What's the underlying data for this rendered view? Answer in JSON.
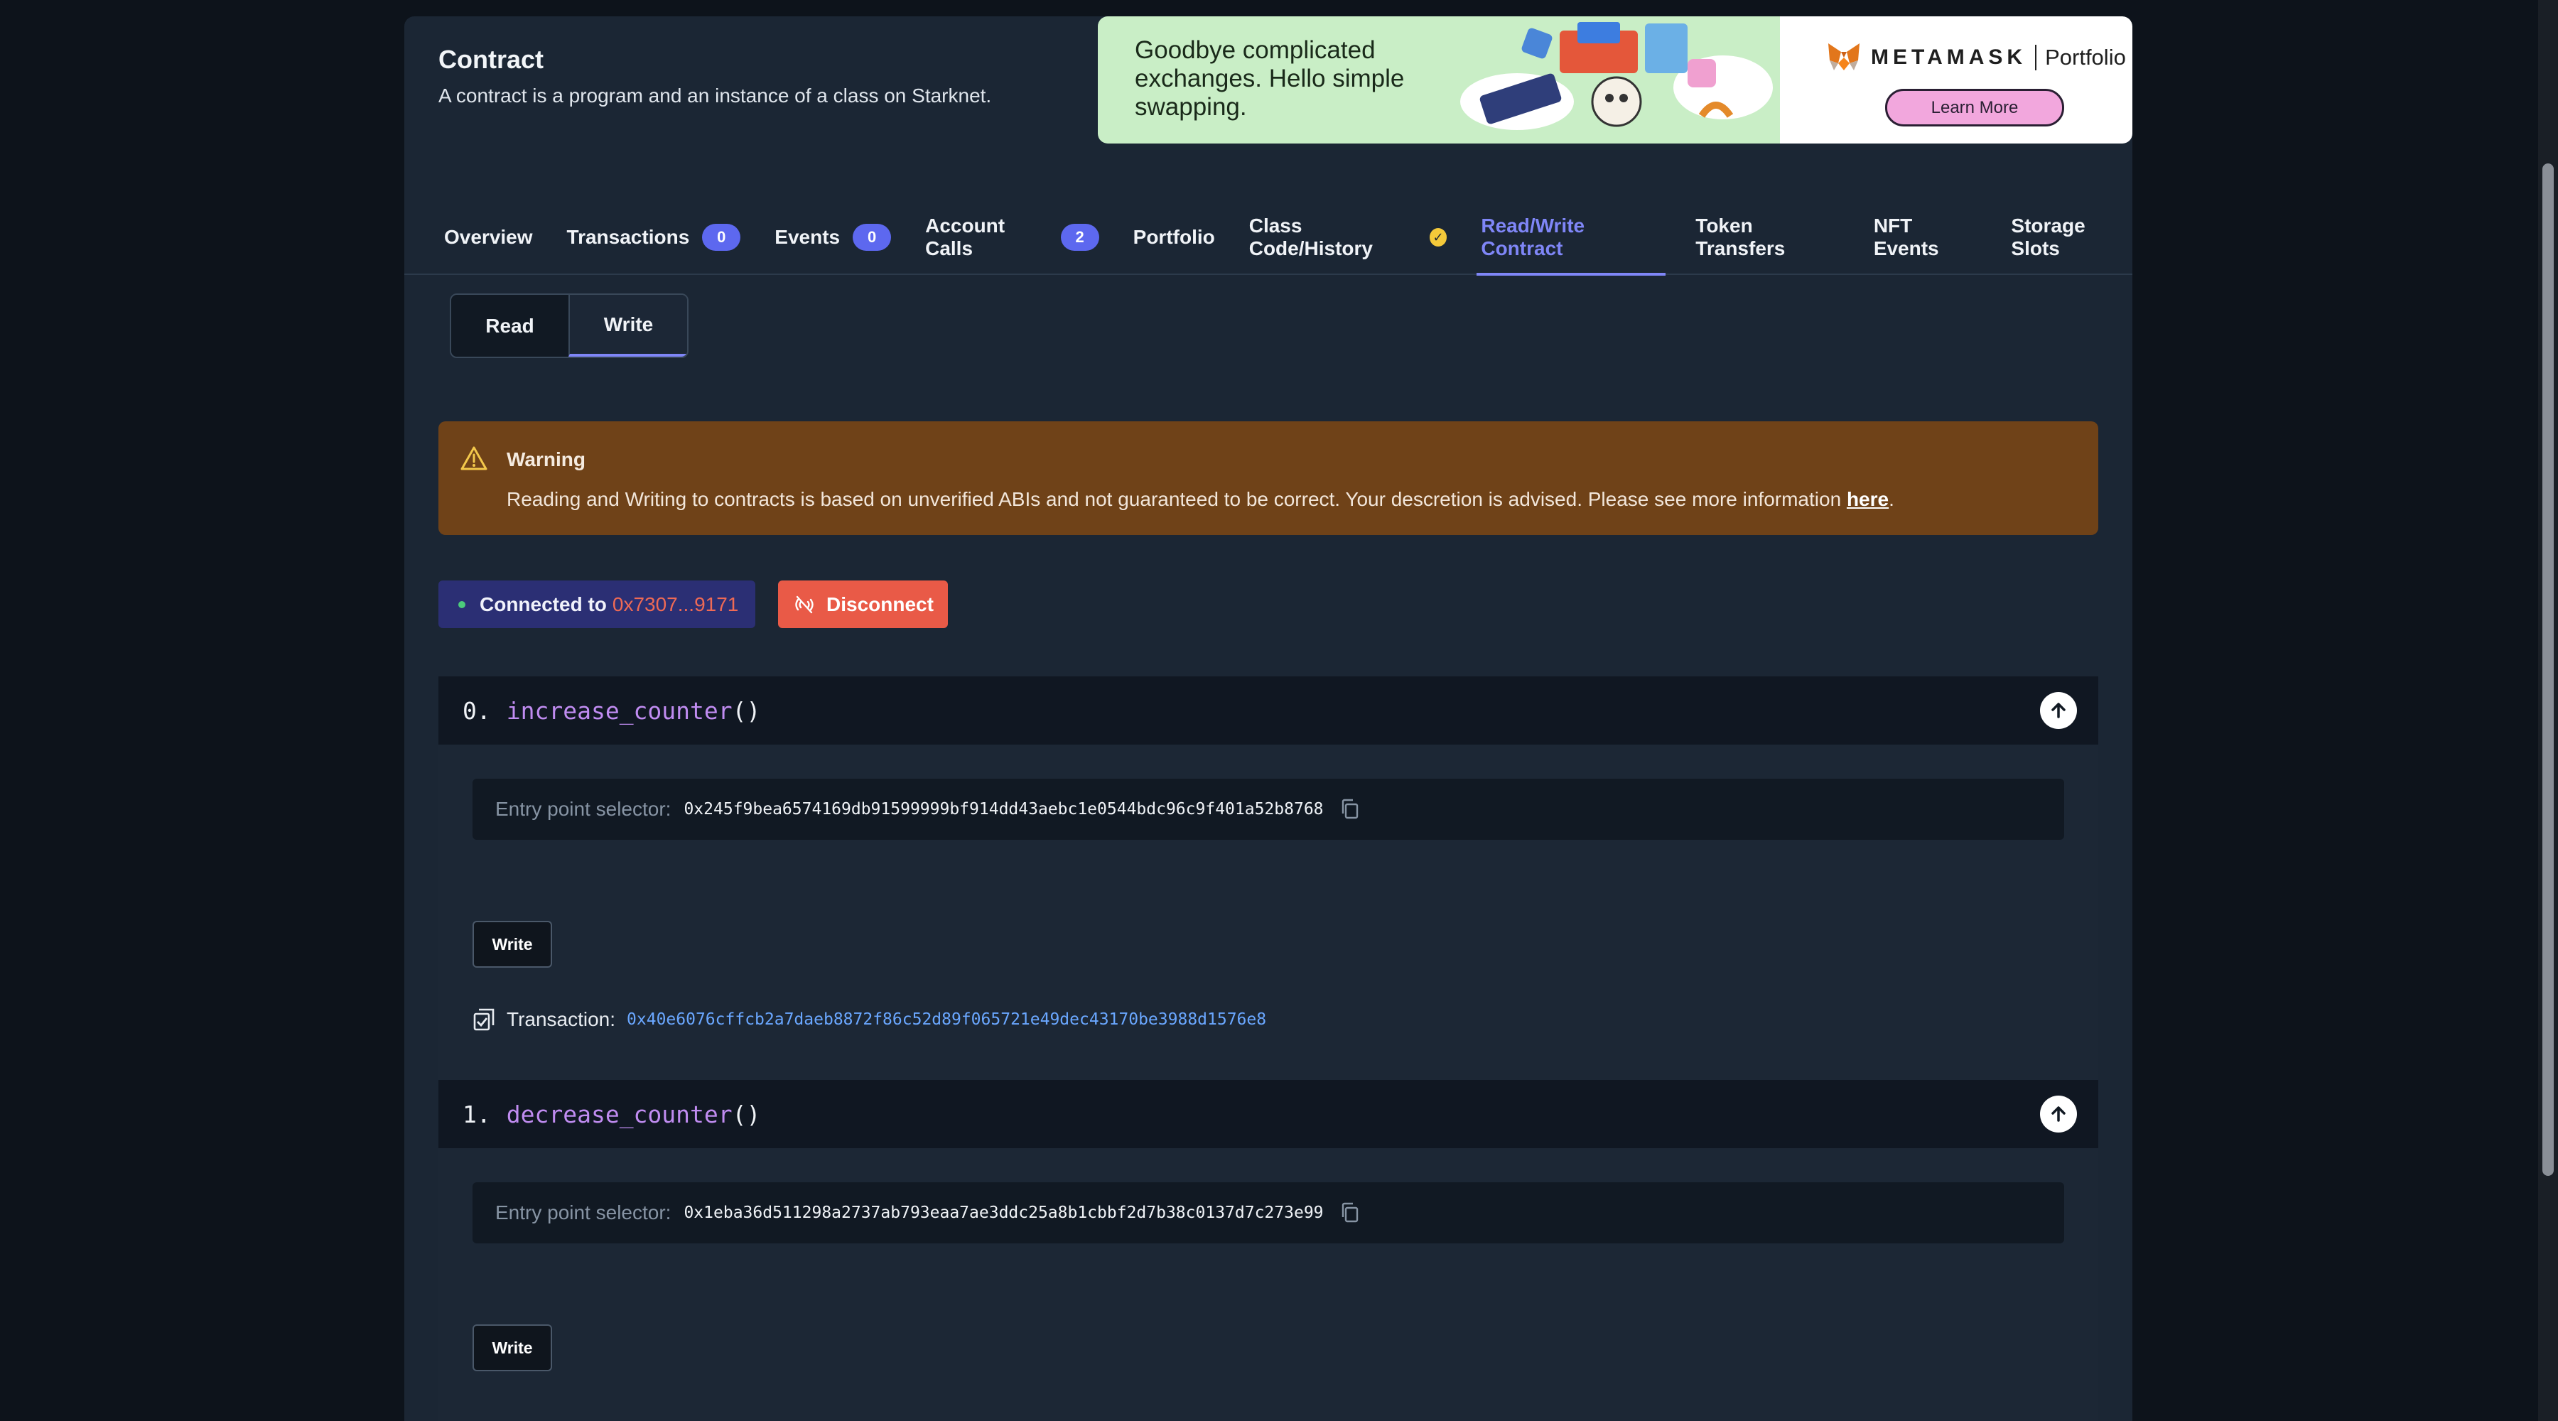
{
  "header": {
    "title": "Contract",
    "subtitle": "A contract is a program and an instance of a class on Starknet."
  },
  "ad": {
    "headline": "Goodbye complicated exchanges. Hello simple swapping.",
    "brand": "METAMASK",
    "product": "Portfolio",
    "cta": "Learn More"
  },
  "tabs": [
    {
      "label": "Overview"
    },
    {
      "label": "Transactions",
      "count": "0"
    },
    {
      "label": "Events",
      "count": "0"
    },
    {
      "label": "Account Calls",
      "count": "2"
    },
    {
      "label": "Portfolio"
    },
    {
      "label": "Class Code/History",
      "verified_icon": "check-badge-icon"
    },
    {
      "label": "Read/Write Contract",
      "active": true
    },
    {
      "label": "Token Transfers"
    },
    {
      "label": "NFT Events"
    },
    {
      "label": "Storage Slots"
    }
  ],
  "mode_toggle": {
    "read_label": "Read",
    "write_label": "Write",
    "selected": "Write"
  },
  "warning": {
    "title": "Warning",
    "text": "Reading and Writing to contracts is based on unverified ABIs and not guaranteed to be correct. Your descretion is advised. Please see more information ",
    "link_text": "here",
    "trailing": "."
  },
  "connection": {
    "prefix": "Connected to",
    "address": "0x7307...9171",
    "disconnect_label": "Disconnect"
  },
  "functions": [
    {
      "index": "0.",
      "name": "increase_counter",
      "parens": "()",
      "selector_label": "Entry point selector:",
      "selector": "0x245f9bea6574169db91599999bf914dd43aebc1e0544bdc96c9f401a52b8768",
      "write_label": "Write",
      "tx_label": "Transaction:",
      "tx_hash": "0x40e6076cffcb2a7daeb8872f86c52d89f065721e49dec43170be3988d1576e8"
    },
    {
      "index": "1.",
      "name": "decrease_counter",
      "parens": "()",
      "selector_label": "Entry point selector:",
      "selector": "0x1eba36d511298a2737ab793eaa7ae3ddc25a8b1cbbf2d7b38c0137d7c273e99",
      "write_label": "Write"
    }
  ],
  "colors": {
    "accent": "#7f86f7",
    "badge": "#5d68ef",
    "warning_bg": "#6f4218",
    "disconnect": "#e95a47",
    "address": "#ef6a55",
    "function_name": "#c08cf1",
    "tx_link": "#6aa7ff"
  }
}
